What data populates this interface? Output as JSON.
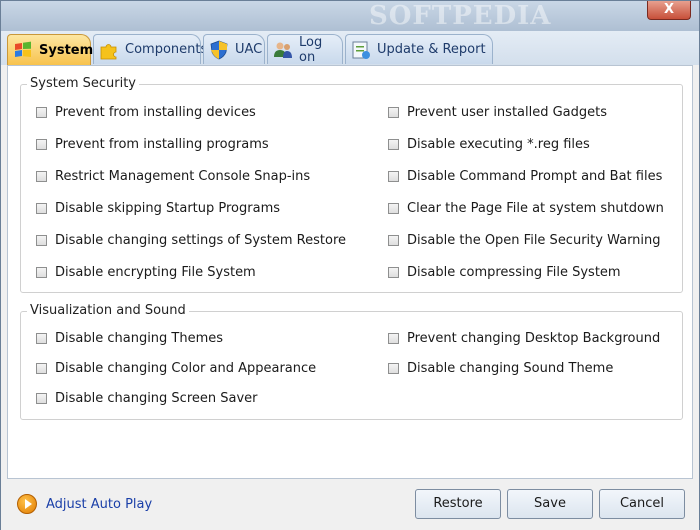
{
  "titlebar": {
    "watermark": "SOFTPEDIA",
    "close_label": "X"
  },
  "tabs": [
    {
      "label": "System",
      "icon": "windows-flag-icon",
      "active": true
    },
    {
      "label": "Components",
      "icon": "puzzle-icon",
      "active": false
    },
    {
      "label": "UAC",
      "icon": "uac-shield-icon",
      "active": false
    },
    {
      "label": "Log on",
      "icon": "users-icon",
      "active": false
    },
    {
      "label": "Update & Report",
      "icon": "update-report-icon",
      "active": false
    }
  ],
  "system_security": {
    "title": "System Security",
    "left": [
      "Prevent from installing devices",
      "Prevent from installing programs",
      "Restrict Management Console Snap-ins",
      "Disable skipping Startup Programs",
      "Disable changing settings of System Restore",
      "Disable encrypting File System"
    ],
    "right": [
      "Prevent user installed Gadgets",
      "Disable executing *.reg files",
      "Disable Command Prompt and Bat files",
      "Clear the Page File at system shutdown",
      "Disable the Open File Security Warning",
      "Disable compressing File System"
    ]
  },
  "visualization": {
    "title": "Visualization and Sound",
    "left": [
      "Disable changing Themes",
      "Disable changing Color and Appearance",
      "Disable changing Screen Saver"
    ],
    "right": [
      "Prevent changing Desktop Background",
      "Disable changing Sound Theme"
    ]
  },
  "footer": {
    "autoplay_label": "Adjust Auto Play",
    "restore_label": "Restore",
    "save_label": "Save",
    "cancel_label": "Cancel"
  }
}
